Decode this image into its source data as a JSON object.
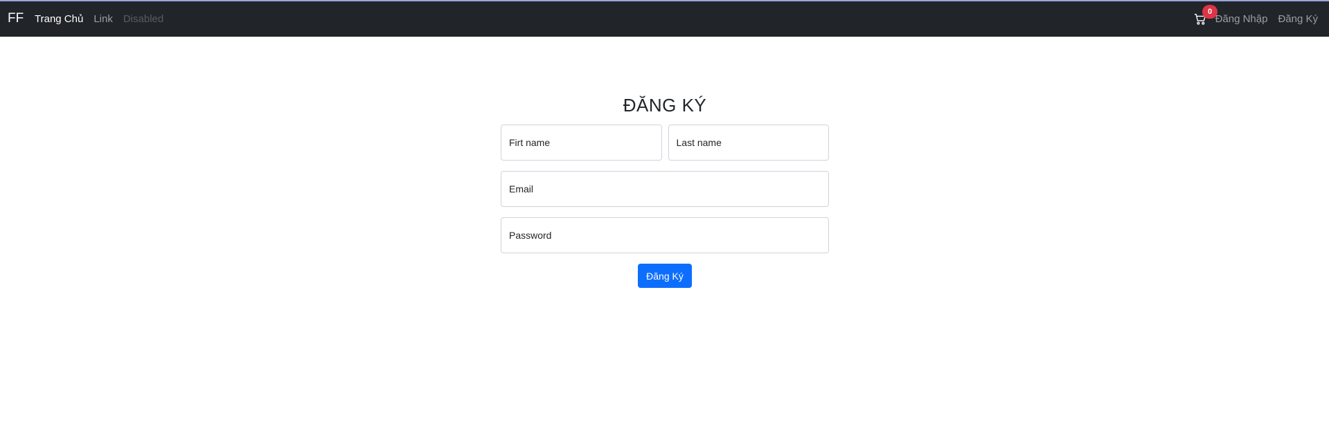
{
  "navbar": {
    "brand": "FF",
    "links": [
      "Trang Chủ",
      "Link",
      "Disabled"
    ],
    "cart_icon": "cart-icon",
    "cart_count": "0",
    "right_links": [
      "Đăng Nhập",
      "Đăng Ký"
    ]
  },
  "form": {
    "title": "ĐĂNG KÝ",
    "first_name_placeholder": "Firt name",
    "last_name_placeholder": "Last name",
    "email_placeholder": "Email",
    "password_placeholder": "Password",
    "submit_label": "Đăng Ký"
  },
  "colors": {
    "navbar_bg": "#212529",
    "primary": "#0d6efd",
    "badge": "#dc3545"
  }
}
